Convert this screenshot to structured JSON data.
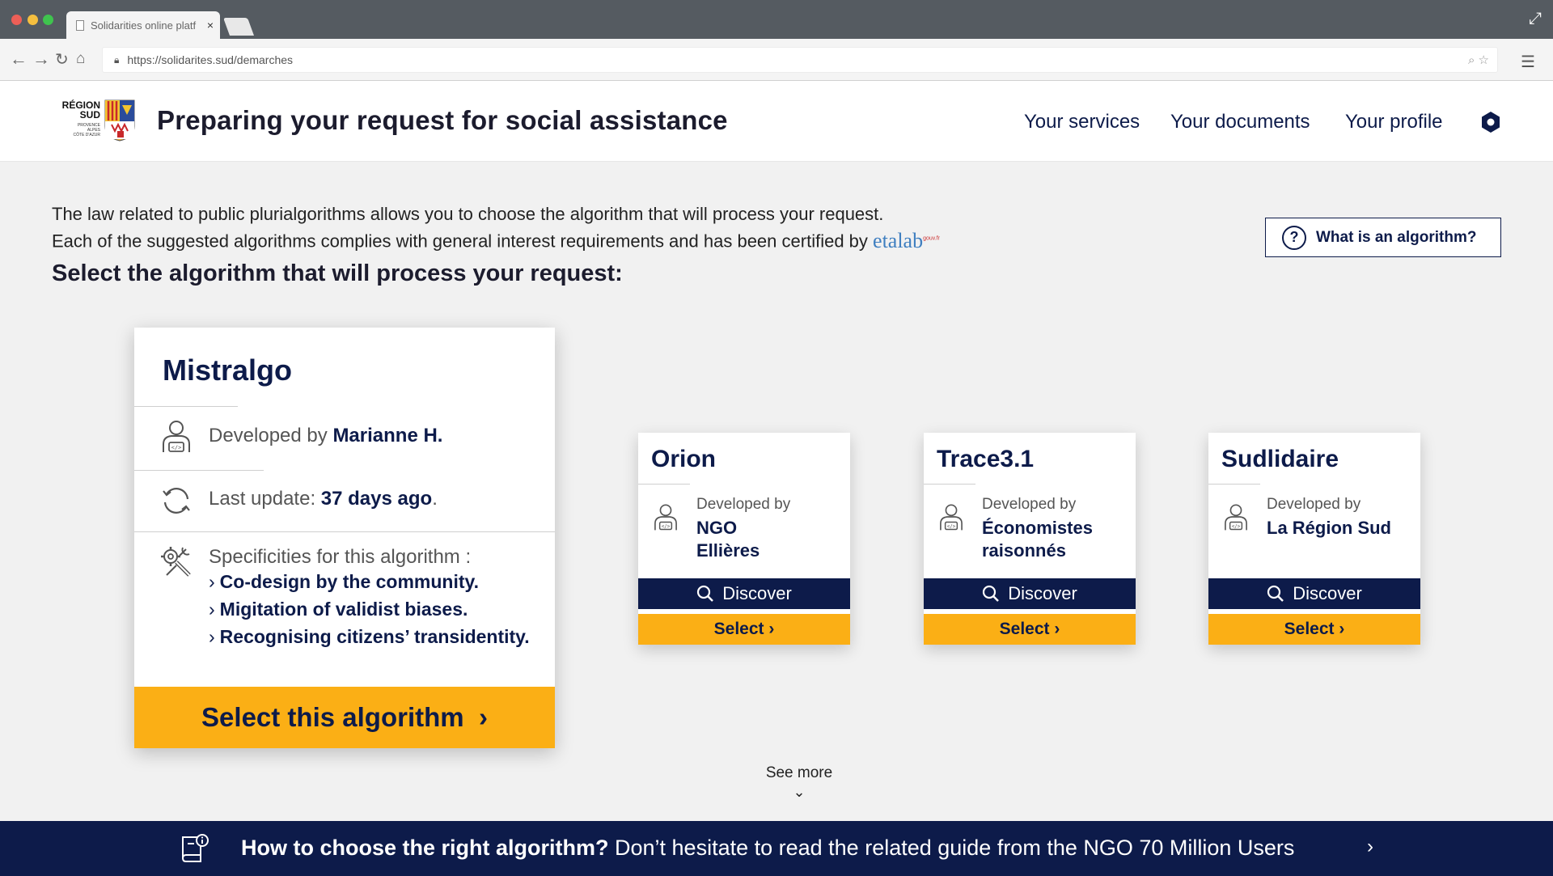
{
  "browser": {
    "tab_title": "Solidarities online platf",
    "tab_close": "×",
    "url": "https://solidarites.sud/demarches"
  },
  "header": {
    "logo_line1": "RÉGION",
    "logo_line2": "SUD",
    "logo_sub1": "PROVENCE",
    "logo_sub2": "ALPES",
    "logo_sub3": "CÔTE D'AZUR",
    "title": "Preparing your request for social assistance",
    "nav": [
      "Your services",
      "Your documents",
      "Your profile"
    ]
  },
  "intro": {
    "line1": "The law related to public plurialgorithms allows you to choose the algorithm that will process your request.",
    "line2": "Each of the suggested algorithms complies with general interest requirements and has been certified by",
    "etalab": "etalab",
    "etalab_sup": "gouv.fr",
    "subtitle": "Select the algorithm that will process your request:",
    "help_button": "What is an algorithm?",
    "help_icon": "?"
  },
  "featured": {
    "name": "Mistralgo",
    "developed_label": "Developed by",
    "developer": "Marianne H.",
    "update_label": "Last update:",
    "update_value": "37 days ago",
    "update_suffix": ".",
    "spec_label": "Specificities for this algorithm :",
    "specs": [
      "Co-design by the community.",
      "Migitation of validist biases.",
      "Recognising citizens’ transidentity."
    ],
    "cta": "Select this algorithm",
    "cta_arrow": "›"
  },
  "cards": [
    {
      "name": "Orion",
      "developed_label": "Developed by",
      "developer": "NGO Ellières",
      "discover": "Discover",
      "select": "Select ›"
    },
    {
      "name": "Trace3.1",
      "developed_label": "Developed by",
      "developer": "Économistes raisonnés",
      "discover": "Discover",
      "select": "Select ›"
    },
    {
      "name": "Sudlidaire",
      "developed_label": "Developed by",
      "developer": "La Région Sud",
      "discover": "Discover",
      "select": "Select ›"
    }
  ],
  "see_more": "See more",
  "banner": {
    "bold": "How to choose the right algorithm?",
    "rest": " Don’t hesitate to read the related guide from the NGO 70 Million Users",
    "arrow": "›"
  },
  "colors": {
    "navy": "#0d1b4a",
    "yellow": "#fbaf15",
    "background": "#f1f1f1"
  }
}
